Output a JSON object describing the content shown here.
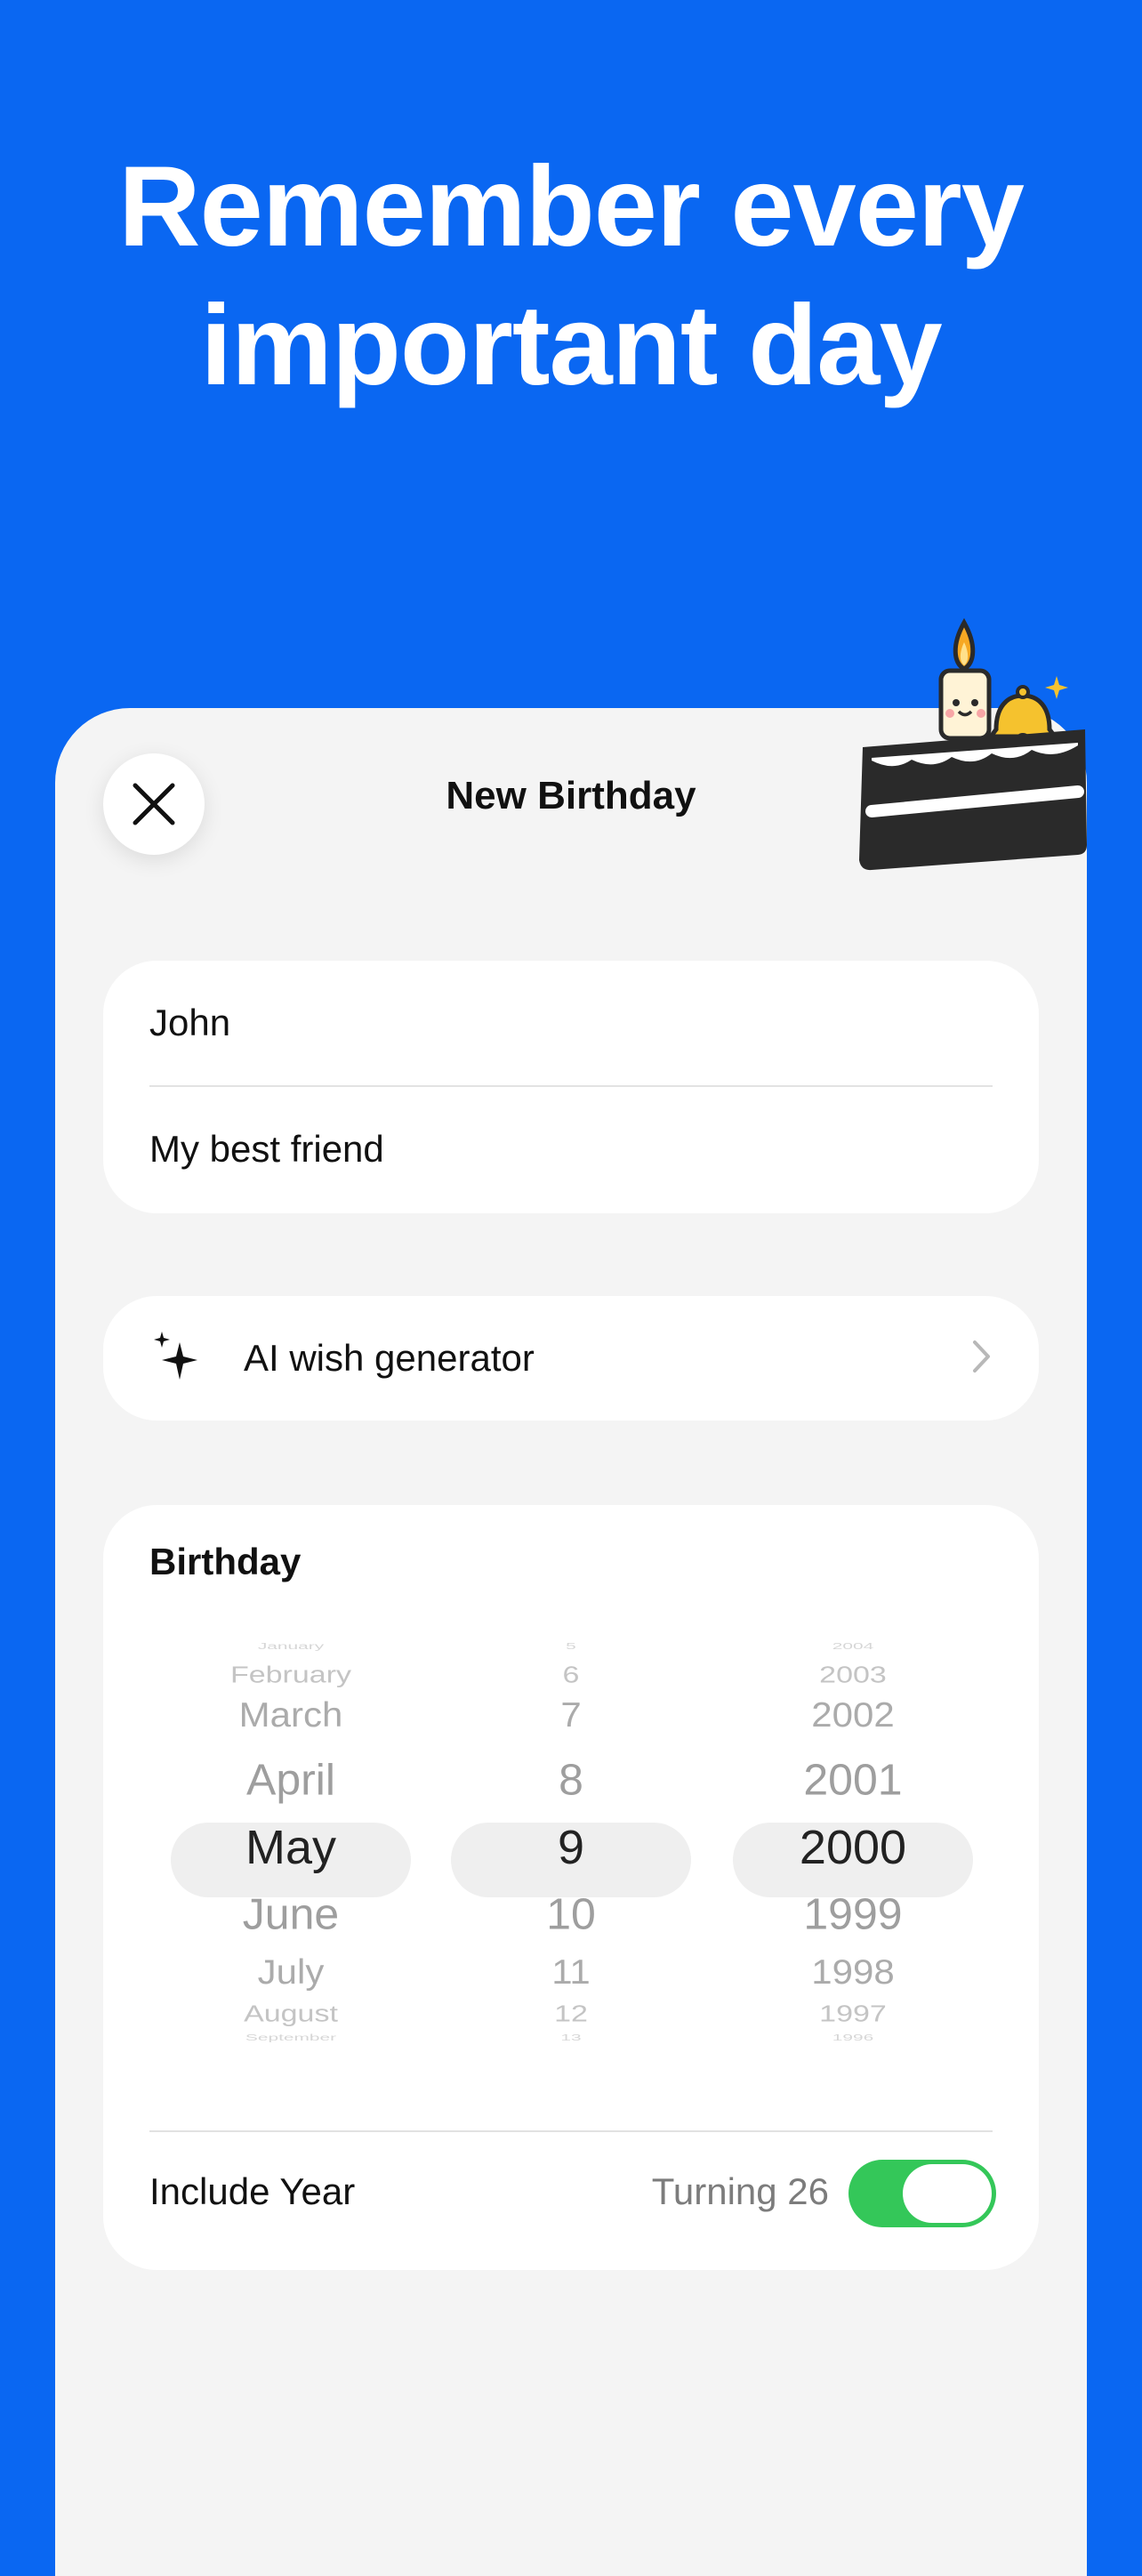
{
  "headline": {
    "line1": "Remember every",
    "line2": "important day"
  },
  "sheet": {
    "title": "New Birthday",
    "close_icon": "close-icon"
  },
  "form": {
    "name_value": "John",
    "note_value": "My best friend"
  },
  "ai_row": {
    "icon": "sparkles-icon",
    "label": "AI wish generator",
    "chevron": "chevron-right-icon"
  },
  "birthday": {
    "title": "Birthday",
    "months": [
      "January",
      "February",
      "March",
      "April",
      "May",
      "June",
      "July",
      "August",
      "September"
    ],
    "days": [
      "5",
      "6",
      "7",
      "8",
      "9",
      "10",
      "11",
      "12",
      "13"
    ],
    "years": [
      "2004",
      "2003",
      "2002",
      "2001",
      "2000",
      "1999",
      "1998",
      "1997",
      "1996"
    ],
    "selected": {
      "month": "May",
      "day": "9",
      "year": "2000"
    },
    "include_year_label": "Include Year",
    "turning_text": "Turning 26",
    "include_year_on": true
  },
  "colors": {
    "background": "#0A67F2",
    "sheet": "#F4F4F4",
    "toggle_on": "#34C759",
    "cake": "#2A2A2A"
  },
  "decoration": {
    "icon": "cake-with-candle-and-bell-icon"
  }
}
